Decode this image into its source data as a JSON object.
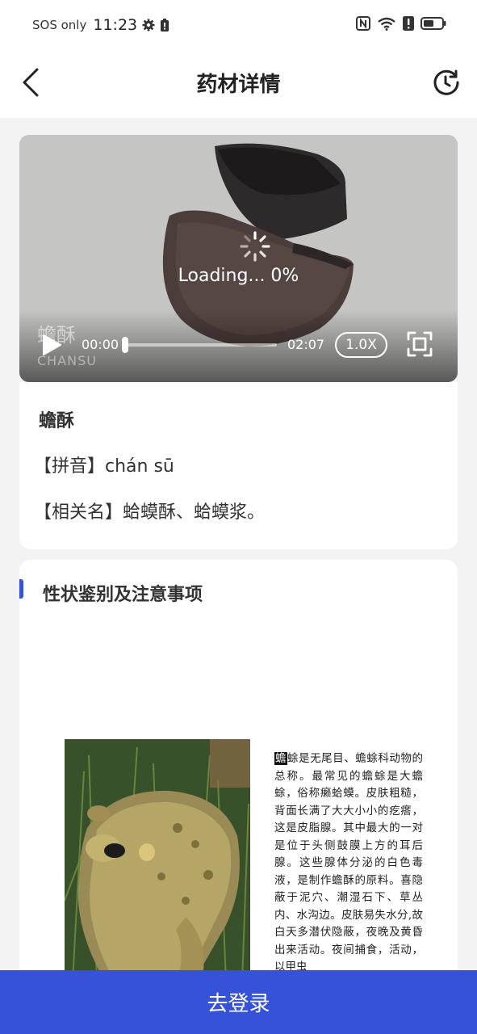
{
  "status_bar": {
    "carrier": "SOS only",
    "time": "11:23",
    "icons": [
      "gear-icon",
      "battery-saver-icon",
      "nfc-icon",
      "wifi-icon",
      "alert-icon",
      "battery-icon"
    ]
  },
  "nav": {
    "title": "药材详情",
    "back_icon": "chevron-left-icon",
    "history_icon": "history-icon"
  },
  "video": {
    "loading_text": "Loading... 0%",
    "watermark_title": "蟾酥",
    "watermark_subtitle": "CHANSU",
    "time_current": "00:00",
    "time_total": "02:07",
    "progress": 0,
    "speed": "1.0X",
    "play_icon": "play-icon",
    "fullscreen_icon": "fullscreen-icon"
  },
  "herb": {
    "name": "蟾酥",
    "pinyin_line": "【拼音】chán sū",
    "related_line": "【相关名】蛤蟆酥、蛤蟆浆。"
  },
  "detail": {
    "section_title": "性状鉴别及注意事项",
    "drop_cap": "蟾",
    "description": "蜍是无尾目、蟾蜍科动物的总称。最常见的蟾蜍是大蟾蜍，俗称癞蛤蟆。皮肤粗糙，背面长满了大大小小的疙瘩，这是皮脂腺。其中最大的一对是位于头侧鼓膜上方的耳后腺。这些腺体分泌的白色毒液，是制作蟾酥的原料。喜隐蔽于泥穴、潮湿石下、草丛内、水沟边。皮肤易失水分,故白天多潜伏隐蔽，夜晚及黄昏出来活动。夜间捕食，活动，以甲虫"
  },
  "footer": {
    "login_label": "去登录"
  },
  "colors": {
    "accent": "#3552d8",
    "background": "#f3f3f3",
    "card": "#ffffff"
  }
}
